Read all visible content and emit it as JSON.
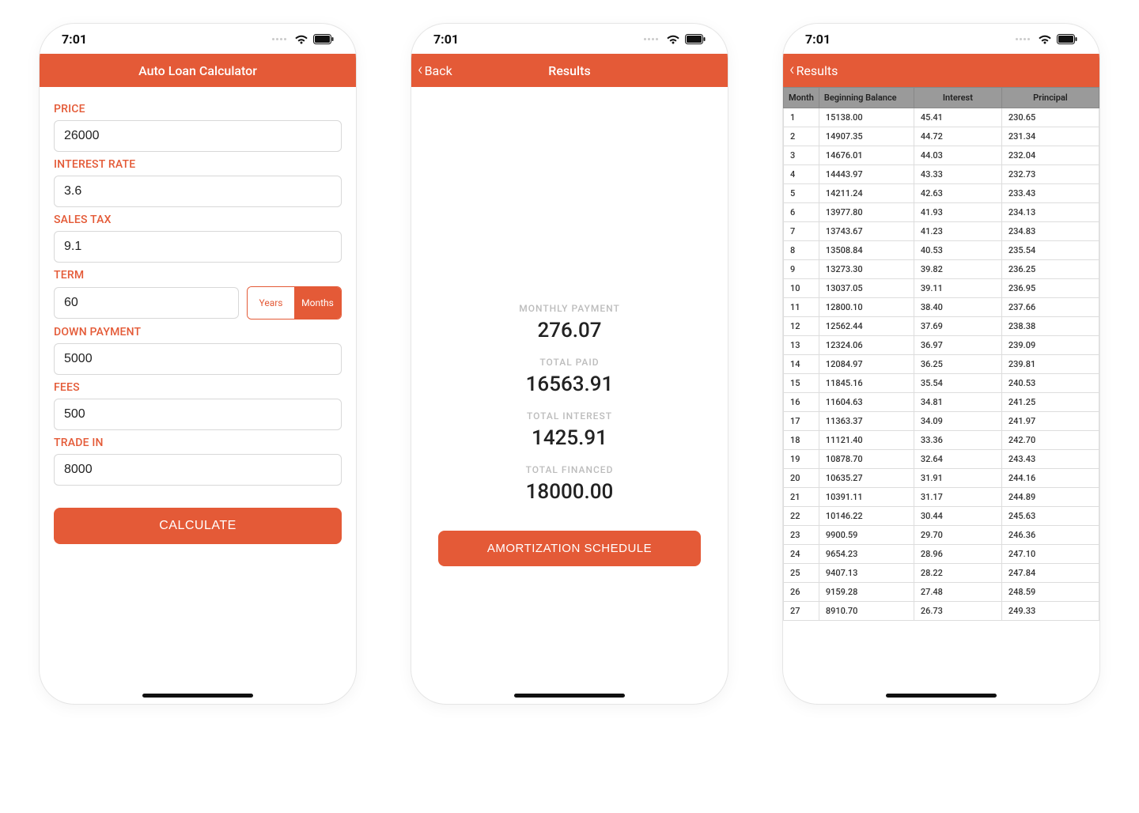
{
  "colors": {
    "accent": "#e45a37"
  },
  "status": {
    "time": "7:01"
  },
  "screen1": {
    "title": "Auto Loan Calculator",
    "labels": {
      "price": "PRICE",
      "interest": "INTEREST RATE",
      "sales_tax": "SALES TAX",
      "term": "TERM",
      "down": "DOWN PAYMENT",
      "fees": "FEES",
      "trade_in": "TRADE IN"
    },
    "values": {
      "price": "26000",
      "interest": "3.6",
      "sales_tax": "9.1",
      "term": "60",
      "down": "5000",
      "fees": "500",
      "trade_in": "8000"
    },
    "term_toggle": {
      "years": "Years",
      "months": "Months",
      "active": "months"
    },
    "calculate": "CALCULATE"
  },
  "screen2": {
    "back": "Back",
    "title": "Results",
    "labels": {
      "monthly": "MONTHLY PAYMENT",
      "total_paid": "TOTAL PAID",
      "total_interest": "TOTAL INTEREST",
      "total_financed": "TOTAL FINANCED"
    },
    "values": {
      "monthly": "276.07",
      "total_paid": "16563.91",
      "total_interest": "1425.91",
      "total_financed": "18000.00"
    },
    "amort_button": "AMORTIZATION SCHEDULE"
  },
  "screen3": {
    "back": "Results",
    "headers": {
      "month": "Month",
      "beginning": "Beginning Balance",
      "interest": "Interest",
      "principal": "Principal"
    },
    "rows": [
      {
        "m": "1",
        "b": "15138.00",
        "i": "45.41",
        "p": "230.65"
      },
      {
        "m": "2",
        "b": "14907.35",
        "i": "44.72",
        "p": "231.34"
      },
      {
        "m": "3",
        "b": "14676.01",
        "i": "44.03",
        "p": "232.04"
      },
      {
        "m": "4",
        "b": "14443.97",
        "i": "43.33",
        "p": "232.73"
      },
      {
        "m": "5",
        "b": "14211.24",
        "i": "42.63",
        "p": "233.43"
      },
      {
        "m": "6",
        "b": "13977.80",
        "i": "41.93",
        "p": "234.13"
      },
      {
        "m": "7",
        "b": "13743.67",
        "i": "41.23",
        "p": "234.83"
      },
      {
        "m": "8",
        "b": "13508.84",
        "i": "40.53",
        "p": "235.54"
      },
      {
        "m": "9",
        "b": "13273.30",
        "i": "39.82",
        "p": "236.25"
      },
      {
        "m": "10",
        "b": "13037.05",
        "i": "39.11",
        "p": "236.95"
      },
      {
        "m": "11",
        "b": "12800.10",
        "i": "38.40",
        "p": "237.66"
      },
      {
        "m": "12",
        "b": "12562.44",
        "i": "37.69",
        "p": "238.38"
      },
      {
        "m": "13",
        "b": "12324.06",
        "i": "36.97",
        "p": "239.09"
      },
      {
        "m": "14",
        "b": "12084.97",
        "i": "36.25",
        "p": "239.81"
      },
      {
        "m": "15",
        "b": "11845.16",
        "i": "35.54",
        "p": "240.53"
      },
      {
        "m": "16",
        "b": "11604.63",
        "i": "34.81",
        "p": "241.25"
      },
      {
        "m": "17",
        "b": "11363.37",
        "i": "34.09",
        "p": "241.97"
      },
      {
        "m": "18",
        "b": "11121.40",
        "i": "33.36",
        "p": "242.70"
      },
      {
        "m": "19",
        "b": "10878.70",
        "i": "32.64",
        "p": "243.43"
      },
      {
        "m": "20",
        "b": "10635.27",
        "i": "31.91",
        "p": "244.16"
      },
      {
        "m": "21",
        "b": "10391.11",
        "i": "31.17",
        "p": "244.89"
      },
      {
        "m": "22",
        "b": "10146.22",
        "i": "30.44",
        "p": "245.63"
      },
      {
        "m": "23",
        "b": "9900.59",
        "i": "29.70",
        "p": "246.36"
      },
      {
        "m": "24",
        "b": "9654.23",
        "i": "28.96",
        "p": "247.10"
      },
      {
        "m": "25",
        "b": "9407.13",
        "i": "28.22",
        "p": "247.84"
      },
      {
        "m": "26",
        "b": "9159.28",
        "i": "27.48",
        "p": "248.59"
      },
      {
        "m": "27",
        "b": "8910.70",
        "i": "26.73",
        "p": "249.33"
      }
    ]
  }
}
